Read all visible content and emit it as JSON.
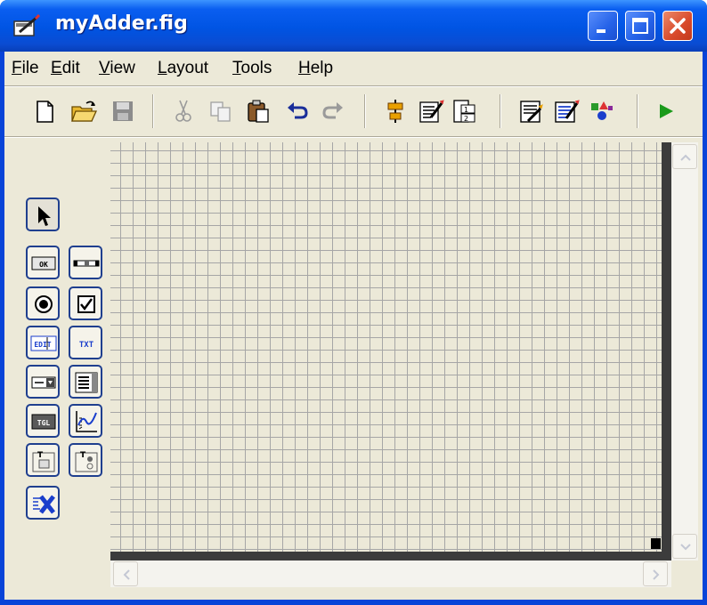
{
  "window": {
    "title": "myAdder.fig",
    "buttons": [
      "minimize-icon",
      "maximize-icon",
      "close-icon"
    ]
  },
  "menu": [
    {
      "pre": "",
      "u": "F",
      "post": "ile"
    },
    {
      "pre": "",
      "u": "E",
      "post": "dit"
    },
    {
      "pre": "",
      "u": "V",
      "post": "iew"
    },
    {
      "pre": "",
      "u": "L",
      "post": "ayout"
    },
    {
      "pre": "",
      "u": "T",
      "post": "ools"
    },
    {
      "pre": "",
      "u": "H",
      "post": "elp"
    }
  ],
  "toolbar": {
    "icons": [
      "new-file-icon",
      "open-folder-icon",
      "save-icon",
      "cut-icon",
      "copy-icon",
      "paste-icon",
      "undo-icon",
      "redo-icon",
      "align-objects-icon",
      "menu-editor-icon",
      "tab-order-editor-icon",
      "m-file-editor-icon",
      "property-inspector-icon",
      "object-browser-icon",
      "run-icon"
    ]
  },
  "palette": {
    "pushbutton_label": "OK",
    "edit_label": "EDIT",
    "text_label": "TXT",
    "toggle_label": "TGL",
    "panel_label": "T",
    "buttongroup_label": "T"
  },
  "colors": {
    "titlebar": "#0054e3",
    "face": "#ece9d8",
    "grid": "#a6a6a6",
    "palette_border": "#1f3f8f",
    "run": "#1a9a1a"
  }
}
